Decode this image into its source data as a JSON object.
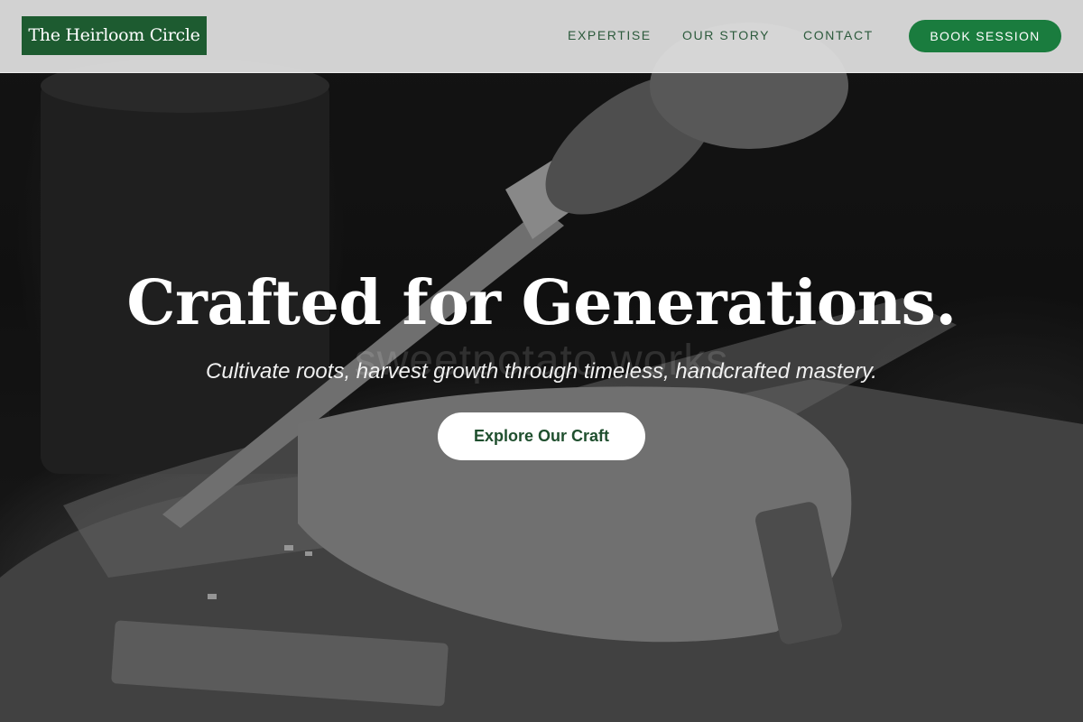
{
  "brand": {
    "name": "The Heirloom Circle"
  },
  "nav": {
    "items": [
      {
        "label": "EXPERTISE"
      },
      {
        "label": "OUR STORY"
      },
      {
        "label": "CONTACT"
      }
    ],
    "cta_label": "BOOK SESSION"
  },
  "hero": {
    "title": "Crafted for Generations.",
    "subtitle": "Cultivate roots, harvest growth through timeless, handcrafted mastery.",
    "cta_label": "Explore Our Craft",
    "watermark": "sweetpotato works",
    "image_description_icon": "wood-carving-photo"
  },
  "colors": {
    "brand_green": "#1d5b30",
    "button_green": "#1a7c3e",
    "nav_text": "#2c5a3c",
    "nav_background": "#dedede"
  }
}
